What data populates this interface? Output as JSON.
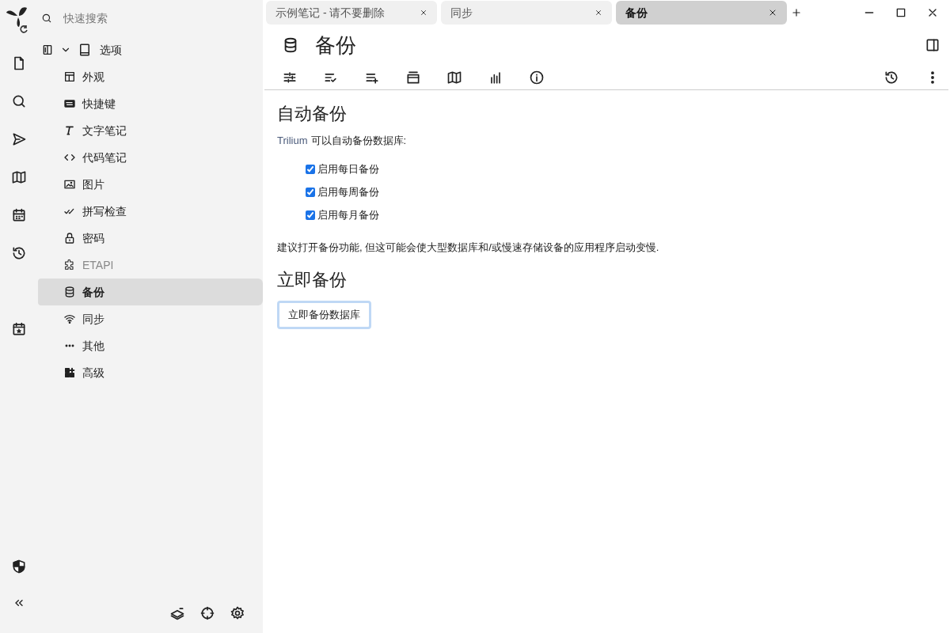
{
  "search": {
    "placeholder": "快速搜索"
  },
  "tree": {
    "root": {
      "label": "选项",
      "expanded": true
    },
    "items": [
      {
        "label": "外观",
        "selected": false,
        "disabled": false
      },
      {
        "label": "快捷键",
        "selected": false,
        "disabled": false
      },
      {
        "label": "文字笔记",
        "selected": false,
        "disabled": false
      },
      {
        "label": "代码笔记",
        "selected": false,
        "disabled": false
      },
      {
        "label": "图片",
        "selected": false,
        "disabled": false
      },
      {
        "label": "拼写检查",
        "selected": false,
        "disabled": false
      },
      {
        "label": "密码",
        "selected": false,
        "disabled": false
      },
      {
        "label": "ETAPI",
        "selected": false,
        "disabled": true
      },
      {
        "label": "备份",
        "selected": true,
        "disabled": false
      },
      {
        "label": "同步",
        "selected": false,
        "disabled": false
      },
      {
        "label": "其他",
        "selected": false,
        "disabled": false
      },
      {
        "label": "高级",
        "selected": false,
        "disabled": false
      }
    ]
  },
  "tabs": [
    {
      "label": "示例笔记 - 请不要删除",
      "selected": false
    },
    {
      "label": "同步",
      "selected": false
    },
    {
      "label": "备份",
      "selected": true
    }
  ],
  "note": {
    "title": "备份",
    "sections": [
      {
        "heading": "自动备份",
        "intro_link": "Trilium",
        "intro": "可以自动备份数据库:",
        "checkboxes": [
          {
            "label": "启用每日备份",
            "checked": true
          },
          {
            "label": "启用每周备份",
            "checked": true
          },
          {
            "label": "启用每月备份",
            "checked": true
          }
        ],
        "note": "建议打开备份功能, 但这可能会使大型数据库和/或慢速存储设备的应用程序启动变慢."
      },
      {
        "heading": "立即备份",
        "button": "立即备份数据库"
      }
    ]
  }
}
